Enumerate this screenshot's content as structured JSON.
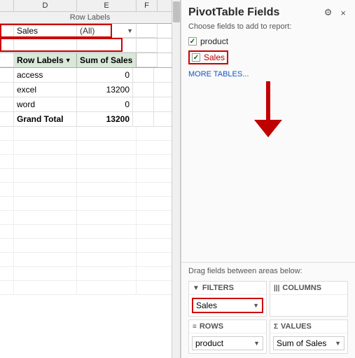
{
  "spreadsheet": {
    "col_d_label": "D",
    "col_e_label": "E",
    "col_f_label": "F",
    "row_labels_bar": "Row Labels",
    "filter_label": "Sales",
    "filter_value": "(All)",
    "pivot_header_row_label": "Row Labels",
    "pivot_header_sum_label": "Sum of Sales",
    "data_rows": [
      {
        "label": "access",
        "value": "0"
      },
      {
        "label": "excel",
        "value": "13200"
      },
      {
        "label": "word",
        "value": "0"
      }
    ],
    "grand_total_label": "Grand Total",
    "grand_total_value": "13200"
  },
  "panel": {
    "title": "PivotTable Fields",
    "subtitle": "Choose fields to add to report:",
    "settings_icon": "⚙",
    "close_icon": "×",
    "fields": [
      {
        "id": "product",
        "label": "product",
        "checked": true
      },
      {
        "id": "sales",
        "label": "Sales",
        "checked": true,
        "highlighted": true
      }
    ],
    "more_tables": "MORE TABLES...",
    "drag_hint": "Drag fields between areas below:",
    "areas": {
      "filters": {
        "icon": "▼",
        "label": "FILTERS",
        "dropdown_value": "Sales",
        "highlighted": true
      },
      "columns": {
        "icon": "|||",
        "label": "COLUMNS",
        "dropdown_value": ""
      },
      "rows": {
        "icon": "≡",
        "label": "ROWS",
        "dropdown_value": "product"
      },
      "values": {
        "icon": "Σ",
        "label": "VALUES",
        "dropdown_value": "Sum of Sales"
      }
    }
  }
}
